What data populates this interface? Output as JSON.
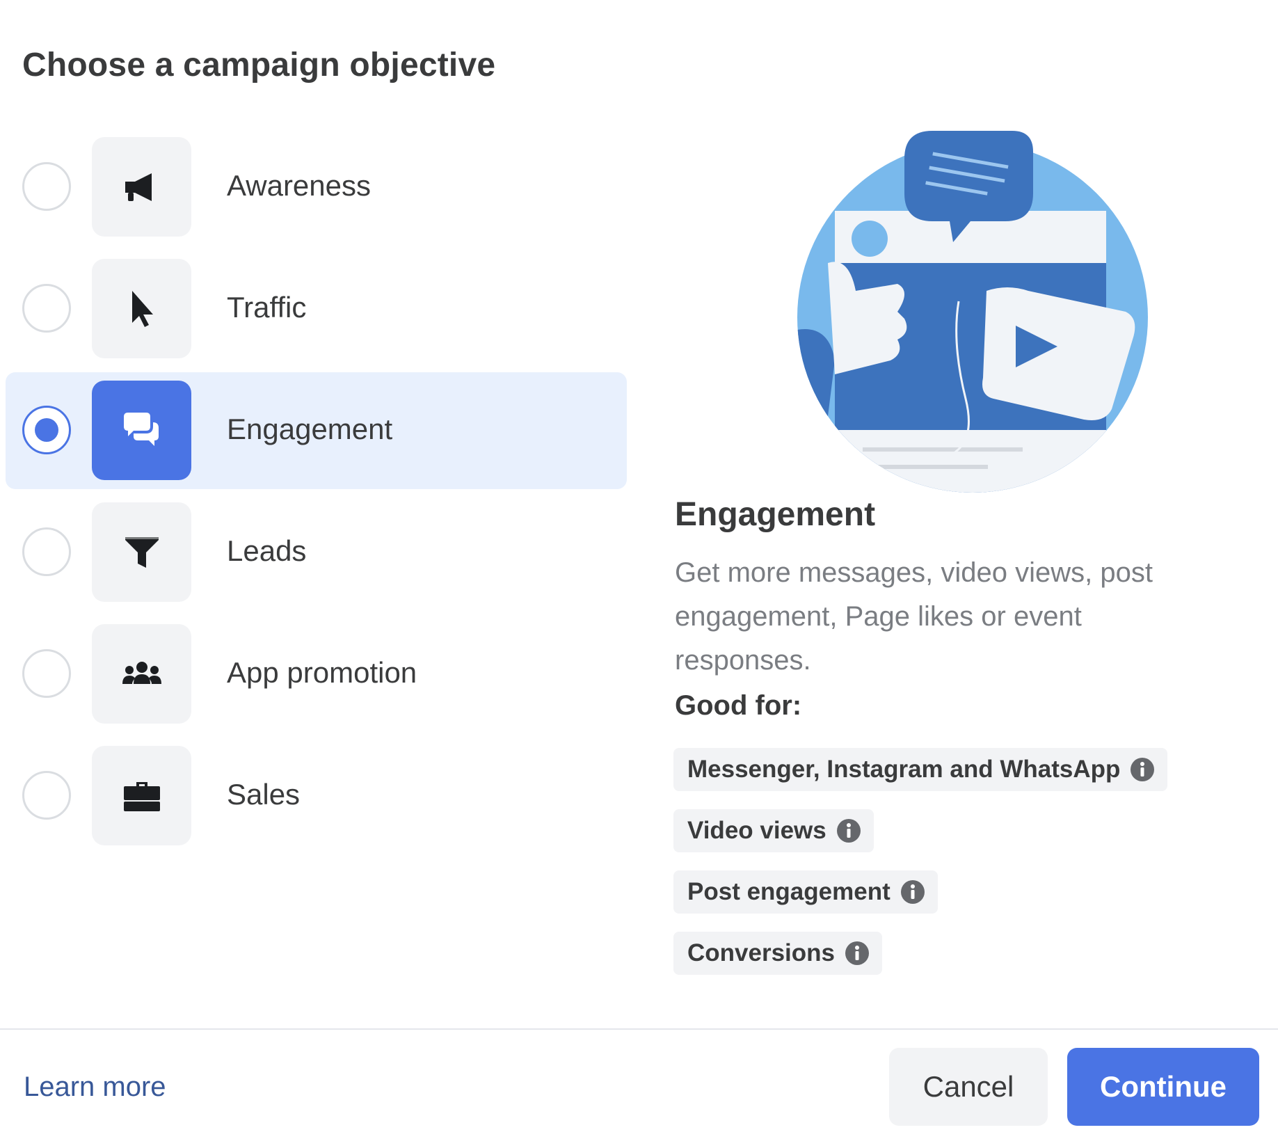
{
  "title": "Choose a campaign objective",
  "objectives": [
    {
      "label": "Awareness",
      "icon": "megaphone-icon",
      "selected": false
    },
    {
      "label": "Traffic",
      "icon": "cursor-icon",
      "selected": false
    },
    {
      "label": "Engagement",
      "icon": "chat-bubbles-icon",
      "selected": true
    },
    {
      "label": "Leads",
      "icon": "funnel-icon",
      "selected": false
    },
    {
      "label": "App promotion",
      "icon": "people-icon",
      "selected": false
    },
    {
      "label": "Sales",
      "icon": "briefcase-icon",
      "selected": false
    }
  ],
  "detail": {
    "title": "Engagement",
    "description": "Get more messages, video views, post engagement, Page likes or event responses.",
    "good_for_label": "Good for:",
    "good_for": [
      "Messenger, Instagram and WhatsApp",
      "Video views",
      "Post engagement",
      "Conversions"
    ]
  },
  "footer": {
    "learn_more": "Learn more",
    "cancel": "Cancel",
    "continue": "Continue"
  },
  "colors": {
    "accent": "#4a74e4",
    "selected_row": "#e8f0fd",
    "tile": "#f2f3f5",
    "link": "#385898"
  }
}
